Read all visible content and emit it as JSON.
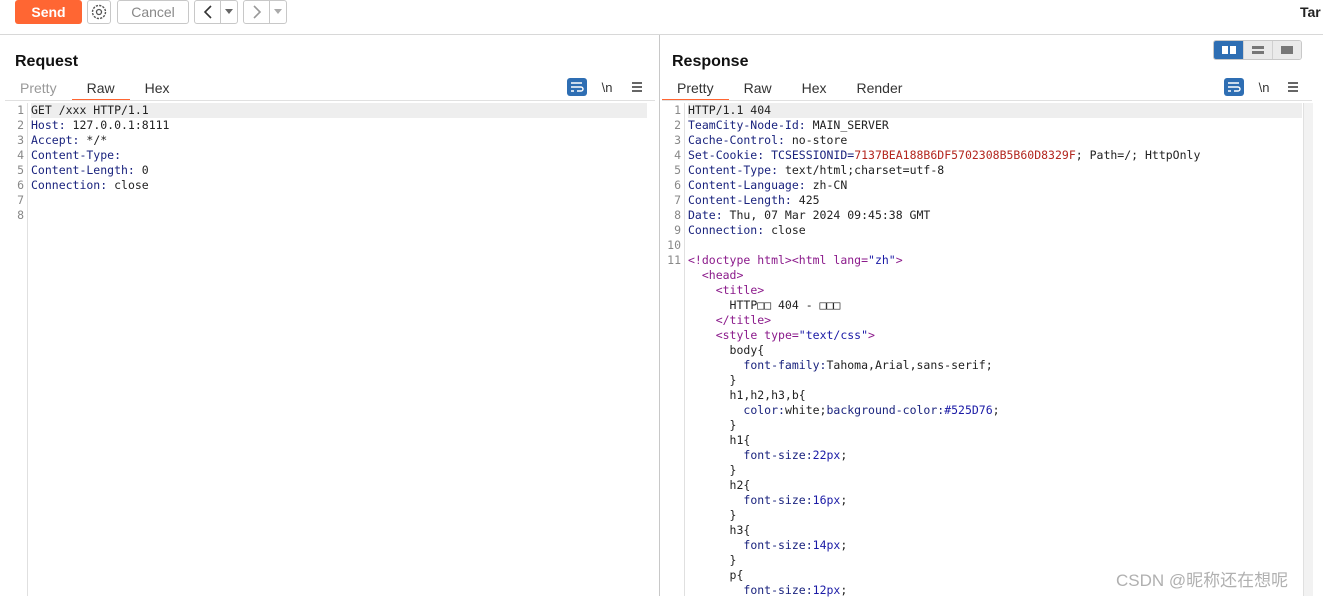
{
  "toolbar": {
    "send_label": "Send",
    "cancel_label": "Cancel",
    "target_label": "Tar"
  },
  "request": {
    "title": "Request",
    "tabs": [
      "Pretty",
      "Raw",
      "Hex"
    ],
    "active_tab": "Raw",
    "newline_label": "\\n",
    "lines": [
      {
        "n": "1",
        "key": "",
        "val": "GET /xxx HTTP/1.1"
      },
      {
        "n": "2",
        "key": "Host:",
        "val": " 127.0.0.1:8111"
      },
      {
        "n": "3",
        "key": "Accept:",
        "val": " */*"
      },
      {
        "n": "4",
        "key": "Content-Type:",
        "val": ""
      },
      {
        "n": "5",
        "key": "Content-Length:",
        "val": " 0"
      },
      {
        "n": "6",
        "key": "Connection:",
        "val": " close"
      },
      {
        "n": "7",
        "key": "",
        "val": ""
      },
      {
        "n": "8",
        "key": "",
        "val": ""
      }
    ]
  },
  "response": {
    "title": "Response",
    "tabs": [
      "Pretty",
      "Raw",
      "Hex",
      "Render"
    ],
    "active_tab": "Pretty",
    "newline_label": "\\n",
    "numbers": [
      "1",
      "2",
      "3",
      "4",
      "5",
      "6",
      "7",
      "8",
      "9",
      "10",
      "11"
    ],
    "headers": {
      "status": "HTTP/1.1 404",
      "node_key": "TeamCity-Node-Id:",
      "node_val": " MAIN_SERVER",
      "cache_key": "Cache-Control:",
      "cache_val": " no-store",
      "cookie_key": "Set-Cookie:",
      "cookie_name": " TCSESSIONID=",
      "cookie_value": "7137BEA188B6DF5702308B5B60D8329F",
      "cookie_rest": "; Path=/; HttpOnly",
      "ctype_key": "Content-Type:",
      "ctype_val": " text/html;charset=utf-8",
      "clang_key": "Content-Language:",
      "clang_val": " zh-CN",
      "clen_key": "Content-Length:",
      "clen_val": " 425",
      "date_key": "Date:",
      "date_val": " Thu, 07 Mar 2024 09:45:38 GMT",
      "conn_key": "Connection:",
      "conn_val": " close"
    },
    "html": {
      "doctype": "<!doctype html>",
      "html_open": "<html",
      "lang_attr": " lang=",
      "lang_val": "\"zh\"",
      "gt": ">",
      "head_open": "<head>",
      "title_open": "<title>",
      "title_text": "HTTP□□ 404 - □□□",
      "title_close": "</title>",
      "style_open": "<style",
      "type_attr": " type=",
      "type_val": "\"text/css\"",
      "css": [
        {
          "indent": 6,
          "parts": [
            {
              "c": "",
              "t": "body{"
            }
          ]
        },
        {
          "indent": 8,
          "parts": [
            {
              "c": "k",
              "t": "font-family:"
            },
            {
              "c": "",
              "t": "Tahoma,Arial,sans-serif;"
            }
          ]
        },
        {
          "indent": 6,
          "parts": [
            {
              "c": "",
              "t": "}"
            }
          ]
        },
        {
          "indent": 6,
          "parts": [
            {
              "c": "",
              "t": "h1,h2,h3,b{"
            }
          ]
        },
        {
          "indent": 8,
          "parts": [
            {
              "c": "k",
              "t": "color:"
            },
            {
              "c": "",
              "t": "white;"
            },
            {
              "c": "k",
              "t": "background-color:"
            },
            {
              "c": "num",
              "t": "#525D76"
            },
            {
              "c": "",
              "t": ";"
            }
          ]
        },
        {
          "indent": 6,
          "parts": [
            {
              "c": "",
              "t": "}"
            }
          ]
        },
        {
          "indent": 6,
          "parts": [
            {
              "c": "",
              "t": "h1{"
            }
          ]
        },
        {
          "indent": 8,
          "parts": [
            {
              "c": "k",
              "t": "font-size:"
            },
            {
              "c": "num",
              "t": "22px"
            },
            {
              "c": "",
              "t": ";"
            }
          ]
        },
        {
          "indent": 6,
          "parts": [
            {
              "c": "",
              "t": "}"
            }
          ]
        },
        {
          "indent": 6,
          "parts": [
            {
              "c": "",
              "t": "h2{"
            }
          ]
        },
        {
          "indent": 8,
          "parts": [
            {
              "c": "k",
              "t": "font-size:"
            },
            {
              "c": "num",
              "t": "16px"
            },
            {
              "c": "",
              "t": ";"
            }
          ]
        },
        {
          "indent": 6,
          "parts": [
            {
              "c": "",
              "t": "}"
            }
          ]
        },
        {
          "indent": 6,
          "parts": [
            {
              "c": "",
              "t": "h3{"
            }
          ]
        },
        {
          "indent": 8,
          "parts": [
            {
              "c": "k",
              "t": "font-size:"
            },
            {
              "c": "num",
              "t": "14px"
            },
            {
              "c": "",
              "t": ";"
            }
          ]
        },
        {
          "indent": 6,
          "parts": [
            {
              "c": "",
              "t": "}"
            }
          ]
        },
        {
          "indent": 6,
          "parts": [
            {
              "c": "",
              "t": "p{"
            }
          ]
        },
        {
          "indent": 8,
          "parts": [
            {
              "c": "k",
              "t": "font-size:"
            },
            {
              "c": "num",
              "t": "12px"
            },
            {
              "c": "",
              "t": ";"
            }
          ]
        }
      ]
    }
  },
  "watermark": "CSDN @昵称还在想呢",
  "colors": {
    "send": "#ff6633",
    "accent": "#2e6eb3"
  }
}
